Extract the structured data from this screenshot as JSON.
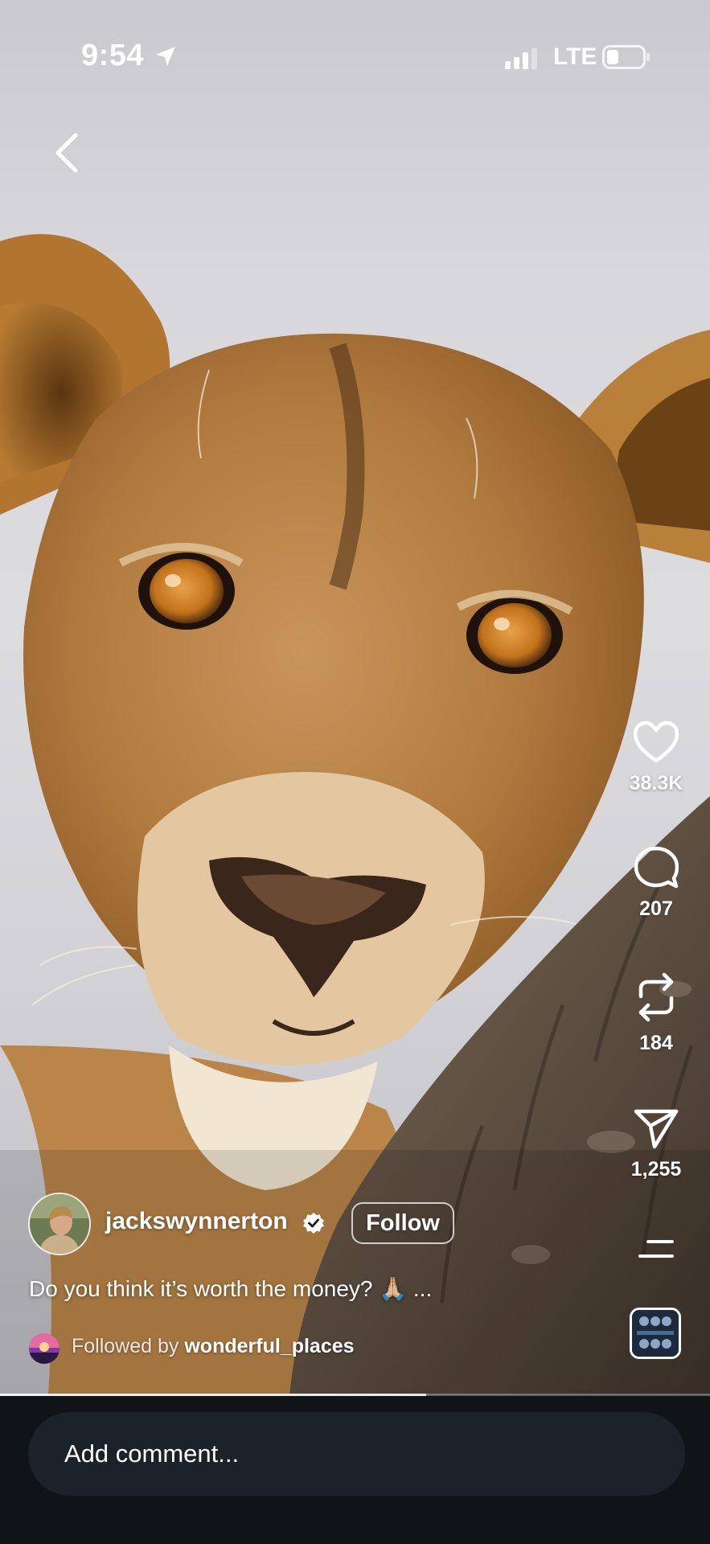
{
  "status_bar": {
    "time": "9:54",
    "network": "LTE"
  },
  "actions": {
    "likes": "38.3K",
    "comments": "207",
    "reposts": "184",
    "shares": "1,255"
  },
  "post": {
    "username": "jackswynnerton",
    "follow_label": "Follow",
    "caption": "Do you think it’s worth the money? 🙏🏼 ...",
    "followed_by_prefix": "Followed by",
    "followed_by_user": "wonderful_places"
  },
  "progress": {
    "fraction": 0.6
  },
  "comment_bar": {
    "placeholder": "Add comment..."
  },
  "icons": {
    "back": "chevron-left-icon",
    "like": "heart-icon",
    "comment": "comment-bubble-icon",
    "repost": "repost-icon",
    "share": "paper-plane-icon",
    "more": "more-lines-icon",
    "location": "location-arrow-icon",
    "verified": "verified-badge-icon"
  },
  "colors": {
    "background": "#0f1419",
    "comment_field": "#1c2229",
    "text": "#ffffff"
  }
}
